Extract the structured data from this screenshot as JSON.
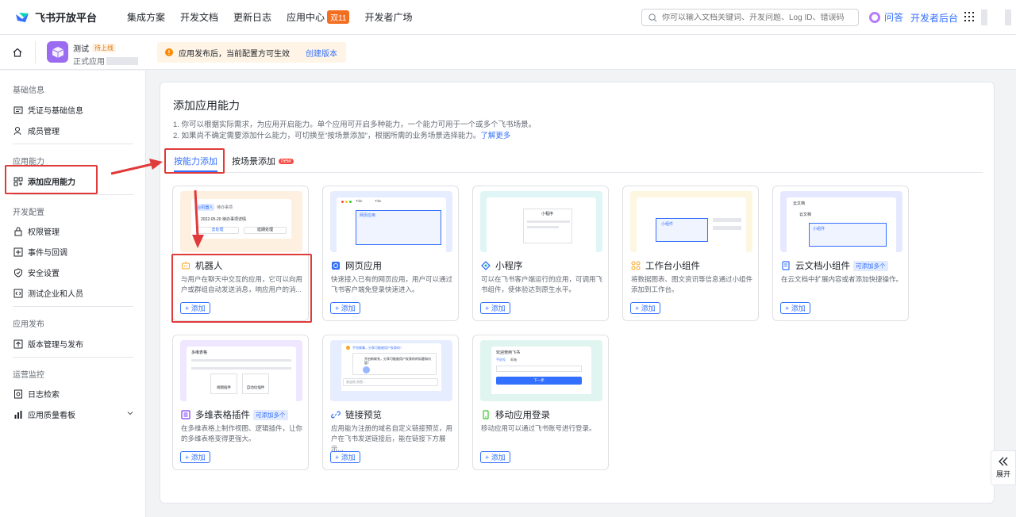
{
  "topnav": {
    "brand": "飞书开放平台",
    "links": [
      {
        "label": "集成方案"
      },
      {
        "label": "开发文档"
      },
      {
        "label": "更新日志"
      },
      {
        "label": "应用中心",
        "badge": "双11"
      },
      {
        "label": "开发者广场"
      }
    ],
    "search_placeholder": "你可以输入文档关键词、开发问题、Log ID、错误码",
    "ask": "问答",
    "console": "开发者后台"
  },
  "appbar": {
    "app_name": "测试",
    "app_status": "待上线",
    "app_sub": "正式应用",
    "notice": "应用发布后，当前配置方可生效",
    "notice_link": "创建版本"
  },
  "sidebar": {
    "sections": [
      {
        "title": "基础信息",
        "items": [
          "凭证与基础信息",
          "成员管理"
        ]
      },
      {
        "title": "应用能力",
        "items": [
          "添加应用能力"
        ]
      },
      {
        "title": "开发配置",
        "items": [
          "权限管理",
          "事件与回调",
          "安全设置",
          "测试企业和人员"
        ]
      },
      {
        "title": "应用发布",
        "items": [
          "版本管理与发布"
        ]
      },
      {
        "title": "运营监控",
        "items": [
          "日志检索",
          "应用质量看板"
        ]
      }
    ]
  },
  "main": {
    "title": "添加应用能力",
    "desc1": "1. 你可以根据实际需求，为应用开启能力。单个应用可开启多种能力，一个能力可用于一个或多个飞书场景。",
    "desc2": "2. 如果尚不确定需要添加什么能力，可切换至“按场景添加”，根据所需的业务场景选择能力。",
    "desc2_link": "了解更多",
    "tabs": [
      {
        "label": "按能力添加"
      },
      {
        "label": "按场景添加",
        "tag": "new"
      }
    ],
    "cards": [
      {
        "title": "机器人",
        "desc": "与用户在聊天中交互的应用，它可以向用户或群组自动发送消息，响应用户的消...",
        "add": "+ 添加"
      },
      {
        "title": "网页应用",
        "desc": "快速接入已有的网页应用，用户可以通过飞书客户端免登录快速进入。",
        "add": "+ 添加"
      },
      {
        "title": "小程序",
        "desc": "可以在飞书客户端运行的应用，可调用飞书组件，使体验达到原生水平。",
        "add": "+ 添加"
      },
      {
        "title": "工作台小组件",
        "desc": "将数据图表、图文资讯等信息通过小组件添加到工作台。",
        "add": "+ 添加"
      },
      {
        "title": "云文档小组件",
        "tag": "可添加多个",
        "desc": "在云文档中扩展内容或者添加快捷操作。",
        "add": "+ 添加"
      },
      {
        "title": "多维表格插件",
        "tag": "可添加多个",
        "desc": "在多维表格上制作视图、逻辑插件，让你的多维表格变得更强大。",
        "add": "+ 添加"
      },
      {
        "title": "链接预览",
        "desc": "应用能为注册的域名自定义链接预览，用户在飞书发送链接后，能在链接下方展示...",
        "add": "+ 添加"
      },
      {
        "title": "移动应用登录",
        "desc": "移动应用可以通过飞书账号进行登录。",
        "add": "+ 添加"
      }
    ],
    "thumbs": {
      "bot_chip": "◎机器人",
      "bot_task": "待办事项",
      "bot_line": "2022-05-20 待办事项详情",
      "bot_btn1": "去处理",
      "bot_btn2": "延期处理",
      "web_t1": "Title",
      "web_t2": "Title",
      "web_app": "网页应用",
      "mp_title": "小程序",
      "wg_label": "小组件",
      "doc_title": "云文档",
      "doc_sub": "云文档",
      "doc_widget": "小组件",
      "bt_title": "多维表格",
      "bt_view": "视图插件",
      "bt_auto": "自动化插件",
      "lp_msg": "不完故事，分享可能被用户发表的！",
      "lp_title": "开启新联系，分享可能被用户发表的的标题和内容！",
      "lp_input": "发送给 消息...",
      "ml_title": "欢迎使用飞书",
      "ml_tab1": "手机号",
      "ml_tab2": "邮箱",
      "ml_btn": "下一步"
    }
  },
  "expand": "展开"
}
